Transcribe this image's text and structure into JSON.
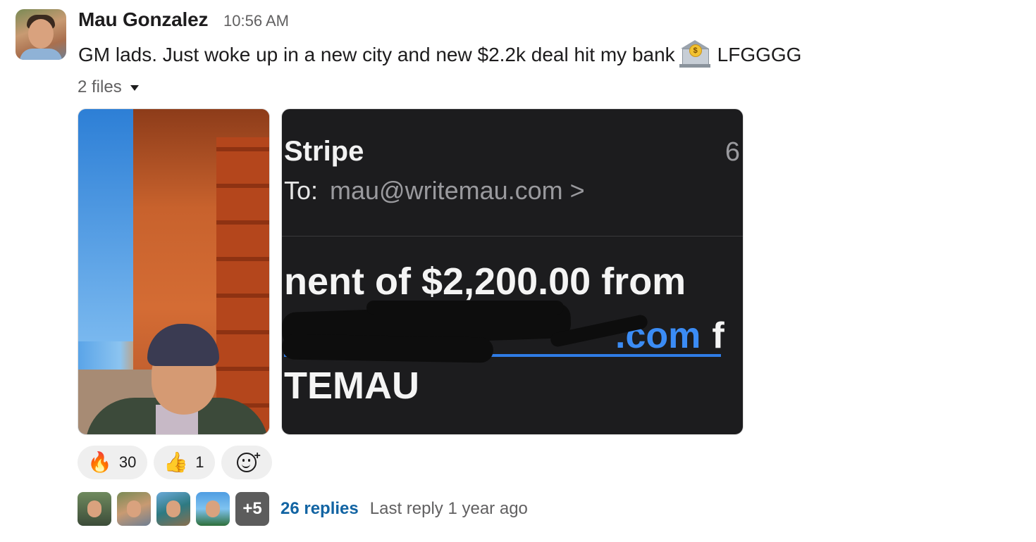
{
  "message": {
    "author": "Mau Gonzalez",
    "time": "10:56 AM",
    "text_before_emoji": "GM lads. Just woke up in a new city and new $2.2k deal hit my bank",
    "emoji": "bank-emoji",
    "text_after_emoji": "LFGGGG"
  },
  "files": {
    "label": "2 files",
    "image1": {
      "kind": "selfie photo"
    },
    "image2": {
      "sender": "Stripe",
      "count": "6",
      "to_label": "To:",
      "to_email": "mau@writemau.com >",
      "payment_line": "nent of $2,200.00 from",
      "link_text": ".com",
      "link_tail": "f",
      "name_line": "TEMAU"
    }
  },
  "reactions": [
    {
      "emoji": "🔥",
      "count": "30"
    },
    {
      "emoji": "👍",
      "count": "1"
    }
  ],
  "thread": {
    "more_count": "+5",
    "replies": "26 replies",
    "last_reply": "Last reply 1 year ago"
  }
}
